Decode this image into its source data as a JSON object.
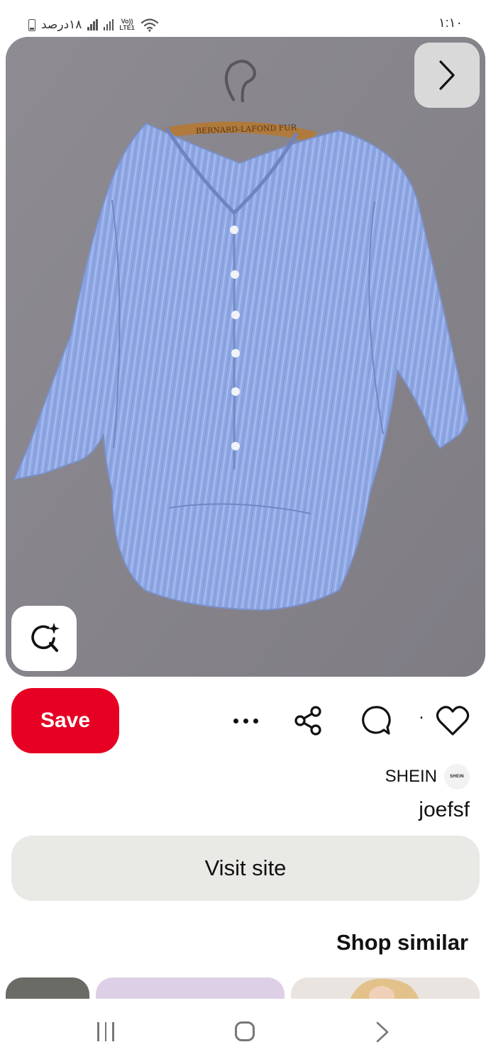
{
  "status_bar": {
    "time": "١:١٠",
    "battery_text": "١٨درصد",
    "network_label": "Vo)) LTE1",
    "icons": [
      "battery-icon",
      "signal-icon",
      "signal-icon",
      "volte-icon",
      "wifi-icon"
    ]
  },
  "pin": {
    "image_description_icon": "striped-shirt-photo",
    "hanger_text": "BERNARD-LAFOND FUR",
    "next_icon": "chevron-right-icon",
    "visual_search_icon": "visual-search-icon"
  },
  "actions": {
    "save_label": "Save",
    "more_icon": "more-dots-icon",
    "share_icon": "share-icon",
    "comment_icon": "comment-icon",
    "reaction_count": "٠",
    "heart_icon": "heart-icon",
    "save_color": "#e60023"
  },
  "source": {
    "name": "SHEIN",
    "avatar_text": "SHEIN",
    "pin_title": "joefsf"
  },
  "visit_site_label": "Visit site",
  "shop_similar_heading": "Shop similar",
  "similar_cards": [
    {
      "color": "#6b6b65"
    },
    {
      "color": "#ddd0e6"
    },
    {
      "color": "#e9e4e0"
    }
  ],
  "nav_bar": {
    "icons": [
      "recents-icon",
      "home-icon",
      "back-icon"
    ]
  }
}
